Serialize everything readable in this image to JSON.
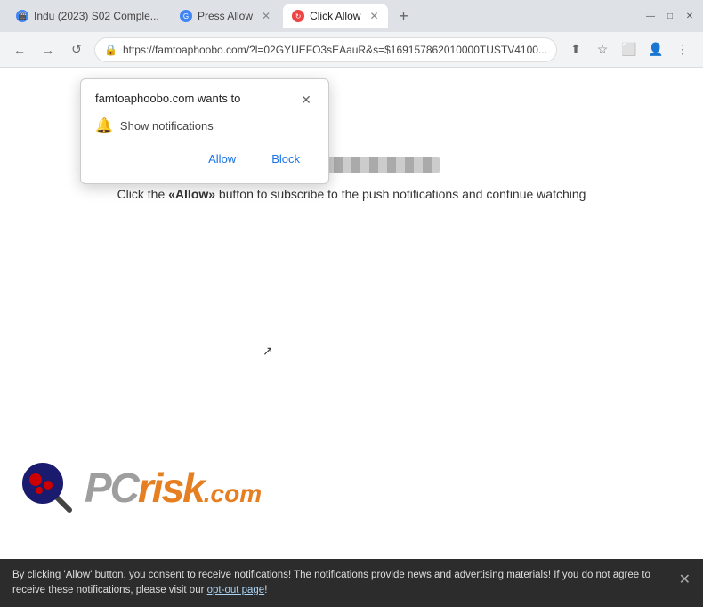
{
  "browser": {
    "tabs": [
      {
        "id": "tab1",
        "label": "Indu (2023) S02 Comple...",
        "active": false,
        "icon": "🎬"
      },
      {
        "id": "tab2",
        "label": "Press Allow",
        "active": false,
        "icon": "🌐"
      },
      {
        "id": "tab3",
        "label": "Click Allow",
        "active": true,
        "icon": "🌐"
      }
    ],
    "url": "https://famtoaphoobo.com/?l=02GYUEFO3sEAauR&s=$169157862010000TUSTV4100...",
    "add_tab_label": "+",
    "window_controls": {
      "minimize": "—",
      "maximize": "□",
      "close": "✕"
    }
  },
  "nav": {
    "back": "←",
    "forward": "→",
    "reload": "↺",
    "lock_icon": "🔒",
    "share": "⬆",
    "bookmark": "☆",
    "extensions": "□",
    "account": "👤",
    "menu": "⋮"
  },
  "popup": {
    "title": "famtoaphoobo.com wants to",
    "close_label": "✕",
    "notification_label": "Show notifications",
    "allow_label": "Allow",
    "block_label": "Block"
  },
  "page": {
    "loading_bar_visible": true,
    "instruction": "Click the «Allow» button to subscribe to the push notifications and continue watching"
  },
  "pcrisk": {
    "pc_text": "PC",
    "risk_text": "risk",
    "com_text": ".com"
  },
  "cookie_bar": {
    "text": "By clicking 'Allow' button, you consent to receive notifications! The notifications provide news and advertising materials! If you do not agree to receive these notifications, please visit our ",
    "link_text": "opt-out page",
    "text_end": "!",
    "close_label": "✕"
  }
}
